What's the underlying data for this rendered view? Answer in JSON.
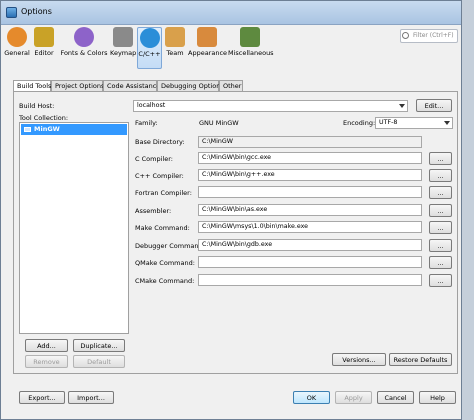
{
  "window": {
    "title": "Options"
  },
  "filter": {
    "placeholder": "Filter (Ctrl+F)"
  },
  "categories": [
    {
      "label": "General",
      "color": "#e58a2c"
    },
    {
      "label": "Editor",
      "color": "#c9a227"
    },
    {
      "label": "Fonts & Colors",
      "color": "#8d63c9"
    },
    {
      "label": "Keymap",
      "color": "#8a8a8a"
    },
    {
      "label": "C/C++",
      "color": "#2b8ed8"
    },
    {
      "label": "Team",
      "color": "#d9a04b"
    },
    {
      "label": "Appearance",
      "color": "#d88a3d"
    },
    {
      "label": "Miscellaneous",
      "color": "#5e8a3f"
    }
  ],
  "tabs": [
    "Build Tools",
    "Project Options",
    "Code Assistance",
    "Debugging Options",
    "Other"
  ],
  "left": {
    "build_host_label": "Build Host:",
    "tool_collection_label": "Tool Collection:",
    "tool_item": "MinGW",
    "add": "Add...",
    "duplicate": "Duplicate...",
    "remove": "Remove",
    "default": "Default"
  },
  "right": {
    "host_value": "localhost",
    "edit": "Edit...",
    "family_label": "Family:",
    "family_value": "GNU MinGW",
    "encoding_label": "Encoding:",
    "encoding_value": "UTF-8",
    "base_dir_label": "Base Directory:",
    "base_dir_value": "C:\\MinGW",
    "rows": [
      {
        "label": "C Compiler:",
        "value": "C:\\MinGW\\bin\\gcc.exe"
      },
      {
        "label": "C++ Compiler:",
        "value": "C:\\MinGW\\bin\\g++.exe"
      },
      {
        "label": "Fortran Compiler:",
        "value": ""
      },
      {
        "label": "Assembler:",
        "value": "C:\\MinGW\\bin\\as.exe"
      },
      {
        "label": "Make Command:",
        "value": "C:\\MinGW\\msys\\1.0\\bin\\make.exe"
      },
      {
        "label": "Debugger Command:",
        "value": "C:\\MinGW\\bin\\gdb.exe"
      },
      {
        "label": "QMake Command:",
        "value": ""
      },
      {
        "label": "CMake Command:",
        "value": ""
      }
    ],
    "browse": "...",
    "versions": "Versions...",
    "restore": "Restore Defaults"
  },
  "footer": {
    "export": "Export...",
    "import": "Import...",
    "ok": "OK",
    "apply": "Apply",
    "cancel": "Cancel",
    "help": "Help"
  }
}
